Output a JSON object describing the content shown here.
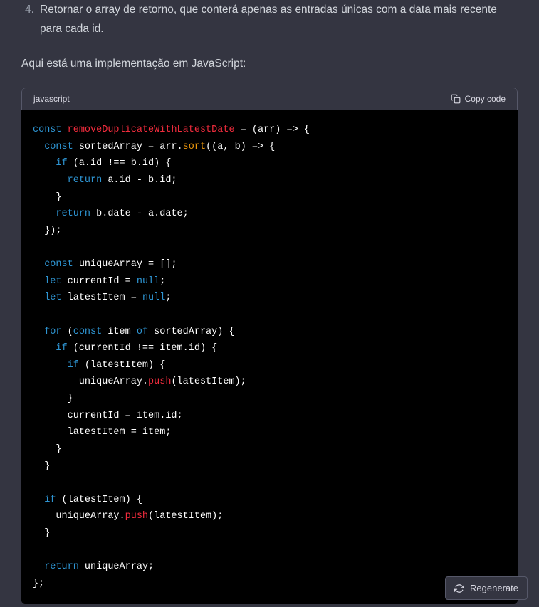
{
  "list": {
    "num": "4.",
    "text": "Retornar o array de retorno, que conterá apenas as entradas únicas com a data mais recente para cada id."
  },
  "intro": "Aqui está uma implementação em JavaScript:",
  "code_header": {
    "lang": "javascript",
    "copy": "Copy code"
  },
  "code": {
    "l1": {
      "kw1": "const",
      "fn": "removeDuplicateWithLatestDate",
      "rest": " = (arr) => {"
    },
    "l2": {
      "kw1": "const",
      "id": " sortedArray = arr.",
      "fn": "sort",
      "rest": "((a, b) => {"
    },
    "l3": {
      "kw1": "if",
      "rest": " (a.id !== b.id) {"
    },
    "l4": {
      "kw1": "return",
      "rest": " a.id - b.id;"
    },
    "l5": "    }",
    "l6": {
      "kw1": "return",
      "rest": " b.date - a.date;"
    },
    "l7": "  });",
    "l8": "",
    "l9": {
      "kw1": "const",
      "rest": " uniqueArray = [];"
    },
    "l10": {
      "kw1": "let",
      "id": " currentId = ",
      "lit": "null",
      "rest": ";"
    },
    "l11": {
      "kw1": "let",
      "id": " latestItem = ",
      "lit": "null",
      "rest": ";"
    },
    "l12": "",
    "l13": {
      "kw1": "for",
      "rest1": " (",
      "kw2": "const",
      "rest2": " item ",
      "kw3": "of",
      "rest3": " sortedArray) {"
    },
    "l14": {
      "kw1": "if",
      "rest": " (currentId !== item.id) {"
    },
    "l15": {
      "kw1": "if",
      "rest": " (latestItem) {"
    },
    "l16": {
      "id": "        uniqueArray.",
      "fn": "push",
      "rest": "(latestItem);"
    },
    "l17": "      }",
    "l18": "      currentId = item.id;",
    "l19": "      latestItem = item;",
    "l20": "    }",
    "l21": "  }",
    "l22": "",
    "l23": {
      "kw1": "if",
      "rest": " (latestItem) {"
    },
    "l24": {
      "id": "    uniqueArray.",
      "fn": "push",
      "rest": "(latestItem);"
    },
    "l25": "  }",
    "l26": "",
    "l27": {
      "kw1": "return",
      "rest": " uniqueArray;"
    },
    "l28": "};"
  },
  "regenerate": "Regenerate"
}
